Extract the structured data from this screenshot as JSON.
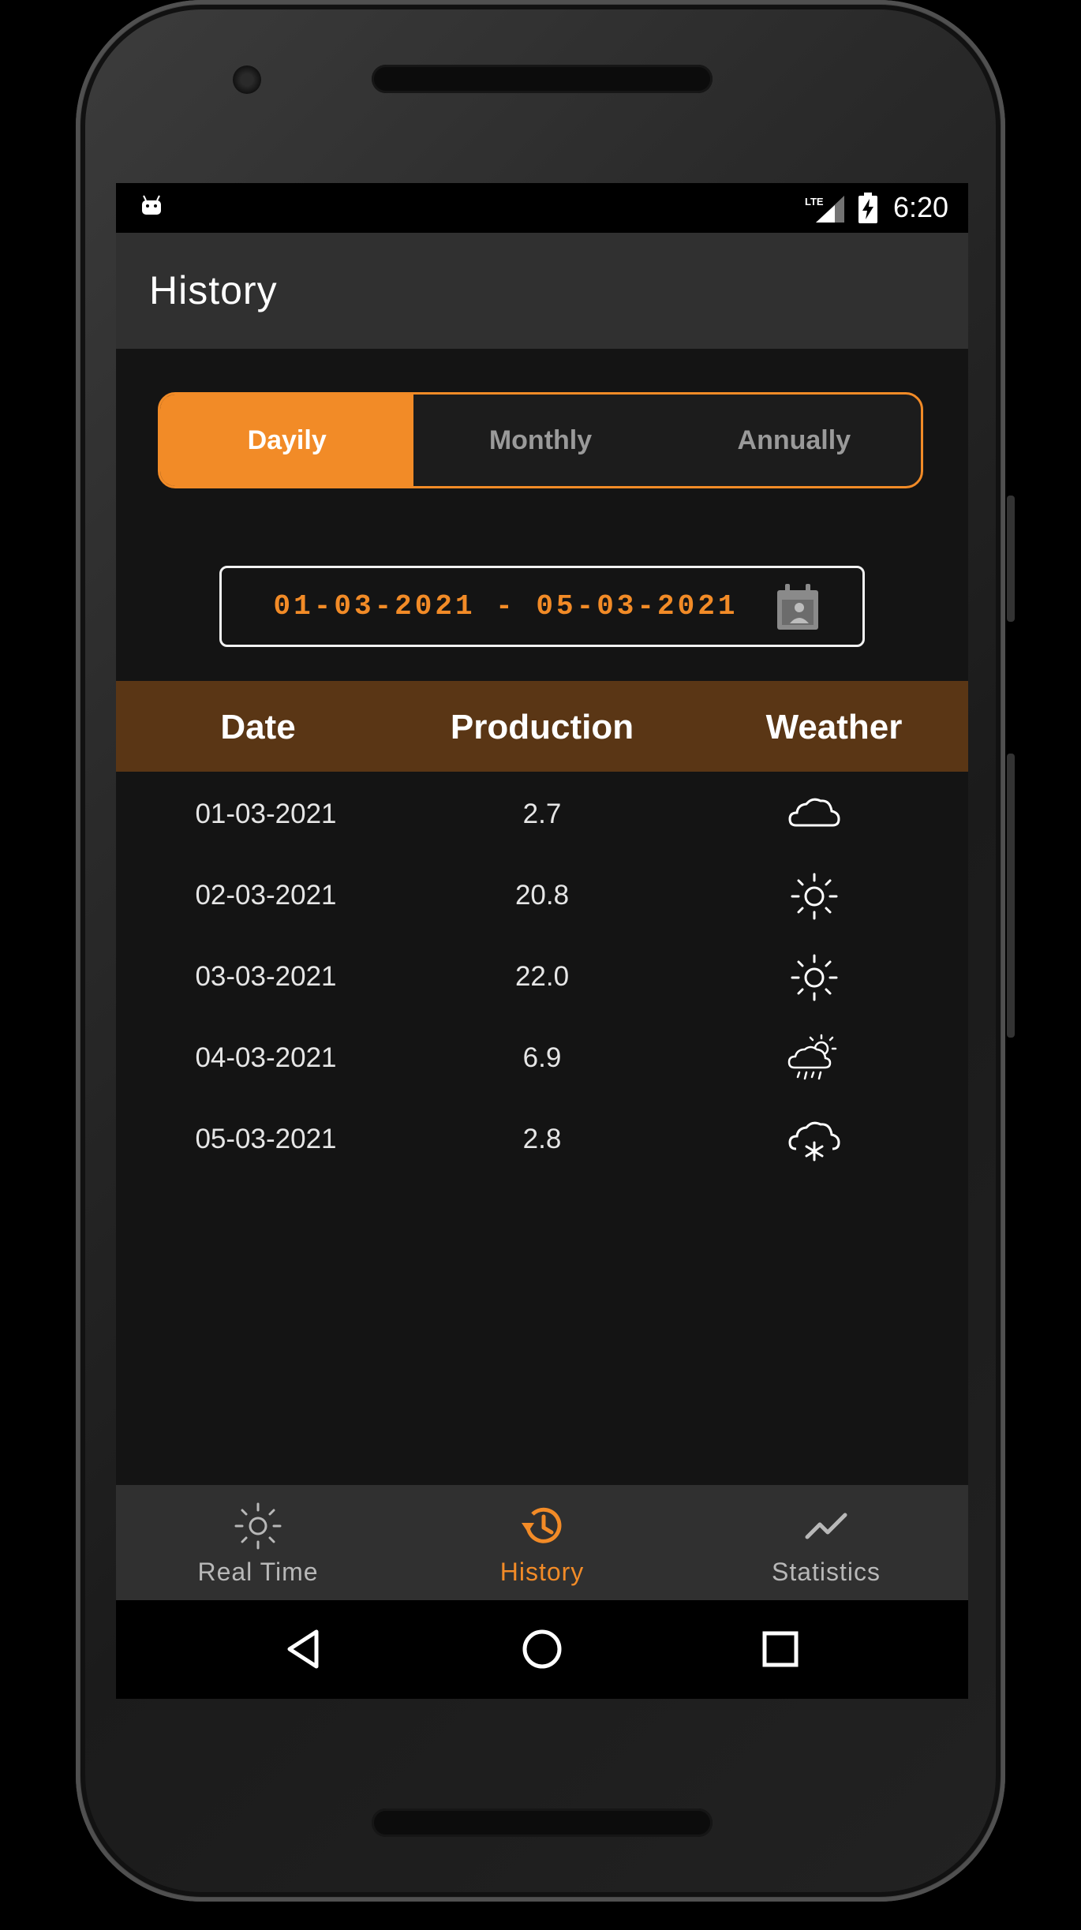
{
  "status_bar": {
    "time": "6:20",
    "network": "LTE",
    "icons": [
      "android-icon",
      "lte-signal-icon",
      "battery-charging-icon"
    ]
  },
  "app_bar": {
    "title": "History"
  },
  "period_tabs": {
    "items": [
      {
        "label": "Dayily",
        "active": true
      },
      {
        "label": "Monthly",
        "active": false
      },
      {
        "label": "Annually",
        "active": false
      }
    ]
  },
  "date_range": {
    "value": "01-03-2021 - 05-03-2021",
    "icon": "calendar-icon"
  },
  "table": {
    "headers": [
      "Date",
      "Production",
      "Weather"
    ],
    "rows": [
      {
        "date": "01-03-2021",
        "production": "2.7",
        "weather": "cloudy-icon"
      },
      {
        "date": "02-03-2021",
        "production": "20.8",
        "weather": "sunny-icon"
      },
      {
        "date": "03-03-2021",
        "production": "22.0",
        "weather": "sunny-icon"
      },
      {
        "date": "04-03-2021",
        "production": "6.9",
        "weather": "partly-cloudy-rain-icon"
      },
      {
        "date": "05-03-2021",
        "production": "2.8",
        "weather": "snow-cloud-icon"
      }
    ]
  },
  "bottom_nav": {
    "items": [
      {
        "label": "Real Time",
        "icon": "sun-icon",
        "active": false
      },
      {
        "label": "History",
        "icon": "history-icon",
        "active": true
      },
      {
        "label": "Statistics",
        "icon": "trend-line-icon",
        "active": false
      }
    ]
  },
  "system_nav": {
    "icons": [
      "back-icon",
      "home-icon",
      "recents-icon"
    ]
  },
  "colors": {
    "accent": "#f28b27",
    "header_brown": "#5a3615",
    "background": "#141414",
    "bar": "#303030"
  }
}
